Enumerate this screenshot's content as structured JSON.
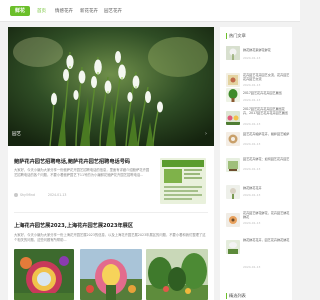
{
  "nav": {
    "logo": "鲜花",
    "items": [
      "首页",
      "情感花卉",
      "新花花卉",
      "园艺花卉"
    ]
  },
  "hero": {
    "label": "园艺",
    "next": "›"
  },
  "posts": [
    {
      "title": "鲍萨花卉园艺招聘电话,鲍萨花卉园艺招聘电话号码",
      "excerpt": "大家好，今天小编为大家分享一份鲍萨花卉园艺招聘电话的信息，里面有详细介绍鲍萨花卉园艺招聘电话的各个问题，不要小看鲍萨园艺下11号的为小编鲜花鲍萨花卉园艺招聘电话...",
      "author": "Shy!Mind",
      "date": "2024-01-13"
    },
    {
      "title": "上海花卉园艺展2023,上海花卉园艺展2023年展区",
      "excerpt": "大家好，今天小编为大家分享一份上海花卉园艺展2023的信息，以及上海花卉园艺展2023年展区的问题，不要小看和我们整理了这个相关的问题，这些问题有所帮助...",
      "author": "Shy!Mind",
      "date": "2024-01-13"
    }
  ],
  "sidebar": {
    "heading": "热门文章",
    "items": [
      {
        "text": "鲜花鲜花束鲜花鲜花",
        "date": "2024-01-13"
      },
      {
        "text": "花卉园艺花卉园艺交流，花卉园艺花卉园艺交流",
        "date": "2024-01-13"
      },
      {
        "text": "2017园艺花卉花卉园艺展览",
        "date": "2024-01-13"
      },
      {
        "text": "2017园艺花卉花卉园艺展览花卉，2017园艺花卉花卉园艺展览",
        "date": "2024-01-13"
      },
      {
        "text": "园艺花卉鲍萨花卉，鲍萨园艺鲍萨",
        "date": "2024-01-13"
      },
      {
        "text": "园艺花卉鲜花：如何园艺花卉园艺",
        "date": "2024-01-13"
      },
      {
        "text": "鲜花鲜花花卉",
        "date": "2024-01-13"
      },
      {
        "text": "花卉园艺鲜花鲜花，花卉园艺鲜花鲜花",
        "date": "2024-01-13"
      },
      {
        "text": "鲜花鲜花花卉，园艺花卉鲜花鲜花",
        "date": "2024-01-13"
      }
    ],
    "heading2": "精选列表"
  }
}
